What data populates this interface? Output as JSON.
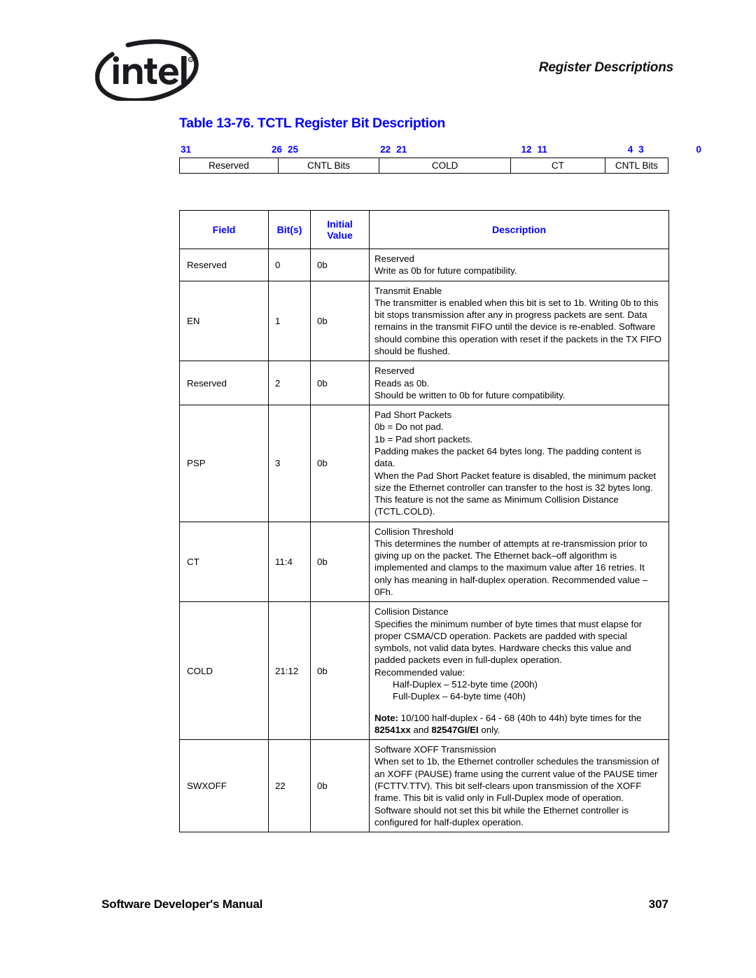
{
  "header": {
    "logo_name": "intel-logo",
    "logo_text": "intel",
    "section_title": "Register Descriptions"
  },
  "table_caption": "Table 13-76. TCTL Register Bit Description",
  "bit_diagram": {
    "accent_color": "#0000FF",
    "bit_labels": [
      {
        "text": "31",
        "left_pct": 0.0,
        "align": "left"
      },
      {
        "text": "26",
        "left_pct": 17.0,
        "align": "left"
      },
      {
        "text": "25",
        "left_pct": 22.2,
        "align": "left"
      },
      {
        "text": "22",
        "left_pct": 39.1,
        "align": "left"
      },
      {
        "text": "21",
        "left_pct": 44.3,
        "align": "left"
      },
      {
        "text": "12",
        "left_pct": 87.2,
        "align": "left"
      },
      {
        "text": "11",
        "left_pct": 92.4,
        "align": "left"
      },
      {
        "text": "4",
        "left_pct": 0.0,
        "align": "right"
      },
      {
        "text": "3",
        "left_pct": 0.0,
        "align": "right"
      },
      {
        "text": "0",
        "left_pct": 0.0,
        "align": "right"
      }
    ],
    "cells": [
      {
        "label": "Reserved",
        "bits": "31:26",
        "width_pct": 21.6
      },
      {
        "label": "CNTL Bits",
        "bits": "25:22",
        "width_pct": 22.2
      },
      {
        "label": "COLD",
        "bits": "21:12",
        "width_pct": 28.8
      },
      {
        "label": "CT",
        "bits": "11:4",
        "width_pct": 20.7
      },
      {
        "label": "CNTL Bits",
        "bits": "3:0",
        "width_pct": 13.7
      }
    ]
  },
  "reg_table": {
    "headers": {
      "field": "Field",
      "bits": "Bit(s)",
      "initial_value_line1": "Initial",
      "initial_value_line2": "Value",
      "description": "Description"
    },
    "rows": [
      {
        "field": "Reserved",
        "bits": "0",
        "initial": "0b",
        "description": [
          {
            "text": "Reserved"
          },
          {
            "text": "Write as 0b for future compatibility."
          }
        ]
      },
      {
        "field": "EN",
        "bits": "1",
        "initial": "0b",
        "description": [
          {
            "text": "Transmit Enable"
          },
          {
            "text": "The transmitter is enabled when this bit is set to 1b. Writing 0b to this bit stops transmission after any in progress packets are sent. Data remains in the transmit FIFO until the device is re-enabled. Software should combine this operation with reset if the packets in the TX FIFO should be flushed."
          }
        ]
      },
      {
        "field": "Reserved",
        "bits": "2",
        "initial": "0b",
        "description": [
          {
            "text": "Reserved"
          },
          {
            "text": "Reads as 0b."
          },
          {
            "text": "Should be written to 0b for future compatibility."
          }
        ]
      },
      {
        "field": "PSP",
        "bits": "3",
        "initial": "0b",
        "description": [
          {
            "text": "Pad Short Packets"
          },
          {
            "text": "0b = Do not pad."
          },
          {
            "text": "1b = Pad short packets."
          },
          {
            "text": "Padding makes the packet 64 bytes long. The padding content is data."
          },
          {
            "text": "When the Pad Short Packet feature is disabled, the minimum packet size the Ethernet controller can transfer to the host is 32 bytes long."
          },
          {
            "text": "This feature is not the same as Minimum Collision Distance (TCTL.COLD)."
          }
        ]
      },
      {
        "field": "CT",
        "bits": "11:4",
        "initial": "0b",
        "description": [
          {
            "text": "Collision Threshold"
          },
          {
            "text": "This determines the number of attempts at re-transmission prior to giving up on the packet. The Ethernet back–off algorithm is implemented and clamps to the maximum value after 16 retries. It only has meaning in half-duplex operation. Recommended value – 0Fh."
          }
        ]
      },
      {
        "field": "COLD",
        "bits": "21:12",
        "initial": "0b",
        "description": [
          {
            "text": "Collision Distance"
          },
          {
            "text": "Specifies the minimum number of byte times that must elapse for proper CSMA/CD operation. Packets are padded with special symbols, not valid data bytes. Hardware checks this value and padded packets even in full-duplex operation."
          },
          {
            "text": "Recommended value:"
          },
          {
            "text": "Half-Duplex – 512-byte time (200h)",
            "indent": true
          },
          {
            "text": "Full-Duplex – 64-byte time (40h)",
            "indent": true
          },
          {
            "text": "",
            "gap": true
          },
          {
            "html": "<b>Note:</b> 10/100 half-duplex - 64 - 68 (40h to 44h) byte times for the <b>82541xx</b> and <b>82547GI/EI</b> only."
          }
        ]
      },
      {
        "field": "SWXOFF",
        "bits": "22",
        "initial": "0b",
        "description": [
          {
            "text": "Software XOFF Transmission"
          },
          {
            "text": "When set to 1b, the Ethernet controller schedules the transmission of an XOFF (PAUSE) frame using the current value of the PAUSE timer (FCTTV.TTV). This bit self-clears upon transmission of the XOFF frame. This bit is valid only in Full-Duplex mode of operation. Software should not set this bit while the Ethernet controller is configured for half-duplex operation."
          }
        ]
      }
    ]
  },
  "footer": {
    "left": "Software Developer's Manual",
    "page_number": "307"
  }
}
